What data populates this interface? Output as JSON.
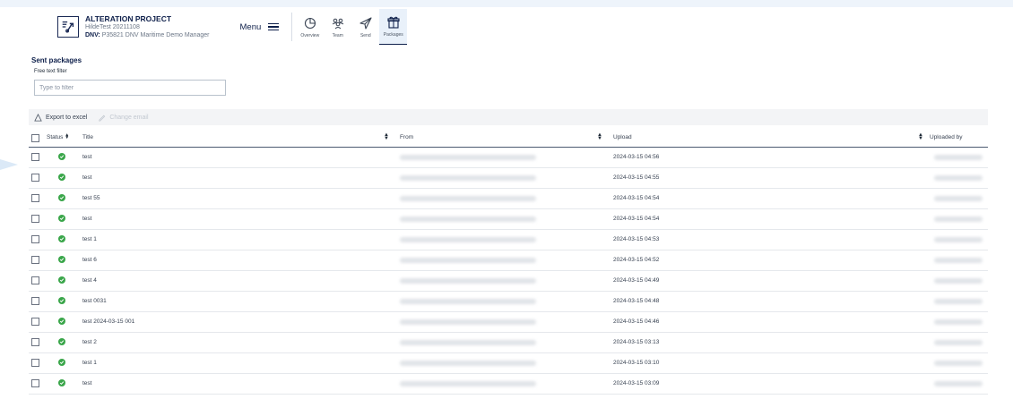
{
  "project": {
    "name": "ALTERATION PROJECT",
    "subtitle": "HildeTest 20211108",
    "dnv_label": "DNV:",
    "dnv_value": "P35821 DNV Maritime Demo Manager"
  },
  "menu": {
    "label": "Menu"
  },
  "nav": {
    "items": [
      {
        "label": "Overview",
        "icon": "overview-icon",
        "active": false
      },
      {
        "label": "Team",
        "icon": "team-icon",
        "active": false
      },
      {
        "label": "Send",
        "icon": "send-icon",
        "active": false
      },
      {
        "label": "Packages",
        "icon": "packages-icon",
        "active": true
      }
    ]
  },
  "page": {
    "title": "Sent packages",
    "filter_label": "Free text filter",
    "filter_placeholder": "Type to filter"
  },
  "toolbar": {
    "export_label": "Export to excel",
    "change_email_label": "Change email"
  },
  "table": {
    "columns": {
      "status": "Status",
      "title": "Title",
      "from": "From",
      "upload": "Upload",
      "uploaded_by": "Uploaded by"
    },
    "rows": [
      {
        "status": "ok",
        "title": "test",
        "upload": "2024-03-15 04:56"
      },
      {
        "status": "ok",
        "title": "test",
        "upload": "2024-03-15 04:55"
      },
      {
        "status": "ok",
        "title": "test 55",
        "upload": "2024-03-15 04:54"
      },
      {
        "status": "ok",
        "title": "test",
        "upload": "2024-03-15 04:54"
      },
      {
        "status": "ok",
        "title": "test 1",
        "upload": "2024-03-15 04:53"
      },
      {
        "status": "ok",
        "title": "test 6",
        "upload": "2024-03-15 04:52"
      },
      {
        "status": "ok",
        "title": "test 4",
        "upload": "2024-03-15 04:49"
      },
      {
        "status": "ok",
        "title": "test 0031",
        "upload": "2024-03-15 04:48"
      },
      {
        "status": "ok",
        "title": "test 2024-03-15 001",
        "upload": "2024-03-15 04:46"
      },
      {
        "status": "ok",
        "title": "test 2",
        "upload": "2024-03-15 03:13"
      },
      {
        "status": "ok",
        "title": "test 1",
        "upload": "2024-03-15 03:10"
      },
      {
        "status": "ok",
        "title": "test",
        "upload": "2024-03-15 03:09"
      }
    ]
  },
  "colors": {
    "brand": "#0f204b",
    "success": "#3aa64a",
    "accent_bg": "#e9f1fa"
  }
}
